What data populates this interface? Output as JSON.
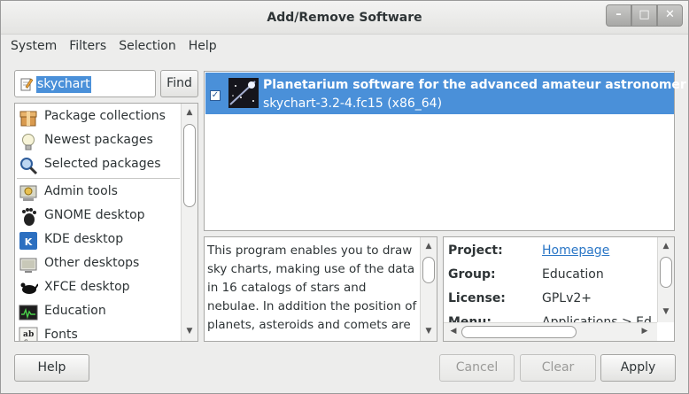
{
  "window": {
    "title": "Add/Remove Software"
  },
  "menubar": {
    "items": [
      "System",
      "Filters",
      "Selection",
      "Help"
    ]
  },
  "search": {
    "value": "skychart",
    "find_label": "Find"
  },
  "groups": {
    "items": [
      {
        "label": "Package collections",
        "icon": "package-collections-icon"
      },
      {
        "label": "Newest packages",
        "icon": "lightbulb-icon"
      },
      {
        "label": "Selected packages",
        "icon": "magnifier-icon"
      },
      {
        "label": "Admin tools",
        "icon": "admin-tools-icon"
      },
      {
        "label": "GNOME desktop",
        "icon": "gnome-foot-icon"
      },
      {
        "label": "KDE desktop",
        "icon": "kde-icon"
      },
      {
        "label": "Other desktops",
        "icon": "other-desktops-icon"
      },
      {
        "label": "XFCE desktop",
        "icon": "xfce-mouse-icon"
      },
      {
        "label": "Education",
        "icon": "education-icon"
      },
      {
        "label": "Fonts",
        "icon": "fonts-icon"
      }
    ]
  },
  "packages": {
    "rows": [
      {
        "summary": "Planetarium software for the advanced amateur astronomer",
        "name": "skychart-3.2-4.fc15 (x86_64)",
        "checked": true
      }
    ]
  },
  "description": {
    "lines": [
      "This program enables you to draw",
      "sky charts, making use of the data",
      "in 16 catalogs of stars and",
      "nebulae. In addition the position of",
      "planets, asteroids and comets are"
    ]
  },
  "details": {
    "rows": [
      {
        "label": "Project:",
        "value": "Homepage",
        "link": true
      },
      {
        "label": "Group:",
        "value": "Education",
        "link": false
      },
      {
        "label": "License:",
        "value": "GPLv2+",
        "link": false
      },
      {
        "label": "Menu:",
        "value": "Applications > Edu",
        "link": false
      }
    ]
  },
  "buttons": {
    "help": "Help",
    "cancel": "Cancel",
    "clear": "Clear",
    "apply": "Apply"
  },
  "colors": {
    "selection": "#4a90d9",
    "link": "#2a76c6"
  }
}
